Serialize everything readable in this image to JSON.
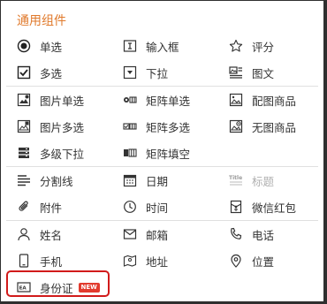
{
  "title": "通用组件",
  "groups": [
    [
      [
        {
          "icon": "radio-icon",
          "label": "单选"
        },
        {
          "icon": "input-box-icon",
          "label": "输入框"
        },
        {
          "icon": "star-icon",
          "label": "评分"
        }
      ],
      [
        {
          "icon": "checkbox-icon",
          "label": "多选"
        },
        {
          "icon": "dropdown-icon",
          "label": "下拉"
        },
        {
          "icon": "image-text-icon",
          "label": "图文"
        }
      ]
    ],
    [
      [
        {
          "icon": "image-radio-icon",
          "label": "图片单选"
        },
        {
          "icon": "matrix-radio-icon",
          "label": "矩阵单选"
        },
        {
          "icon": "image-product-icon",
          "label": "配图商品"
        }
      ],
      [
        {
          "icon": "image-checkbox-icon",
          "label": "图片多选"
        },
        {
          "icon": "matrix-checkbox-icon",
          "label": "矩阵多选"
        },
        {
          "icon": "no-image-product-icon",
          "label": "无图商品"
        }
      ],
      [
        {
          "icon": "multi-level-dropdown-icon",
          "label": "多级下拉"
        },
        {
          "icon": "matrix-fill-icon",
          "label": "矩阵填空"
        }
      ]
    ],
    [
      [
        {
          "icon": "separator-icon",
          "label": "分割线"
        },
        {
          "icon": "calendar-icon",
          "label": "日期"
        },
        {
          "icon": "title-icon",
          "label": "标题",
          "muted": true
        }
      ],
      [
        {
          "icon": "attachment-icon",
          "label": "附件"
        },
        {
          "icon": "clock-icon",
          "label": "时间"
        },
        {
          "icon": "red-envelope-icon",
          "label": "微信红包"
        }
      ]
    ],
    [
      [
        {
          "icon": "person-icon",
          "label": "姓名"
        },
        {
          "icon": "mail-icon",
          "label": "邮箱"
        },
        {
          "icon": "phone-icon",
          "label": "电话"
        }
      ],
      [
        {
          "icon": "mobile-icon",
          "label": "手机"
        },
        {
          "icon": "map-icon",
          "label": "地址"
        },
        {
          "icon": "location-icon",
          "label": "位置"
        }
      ],
      [
        {
          "icon": "id-card-icon",
          "label": "身份证",
          "badge": "NEW"
        }
      ]
    ]
  ]
}
